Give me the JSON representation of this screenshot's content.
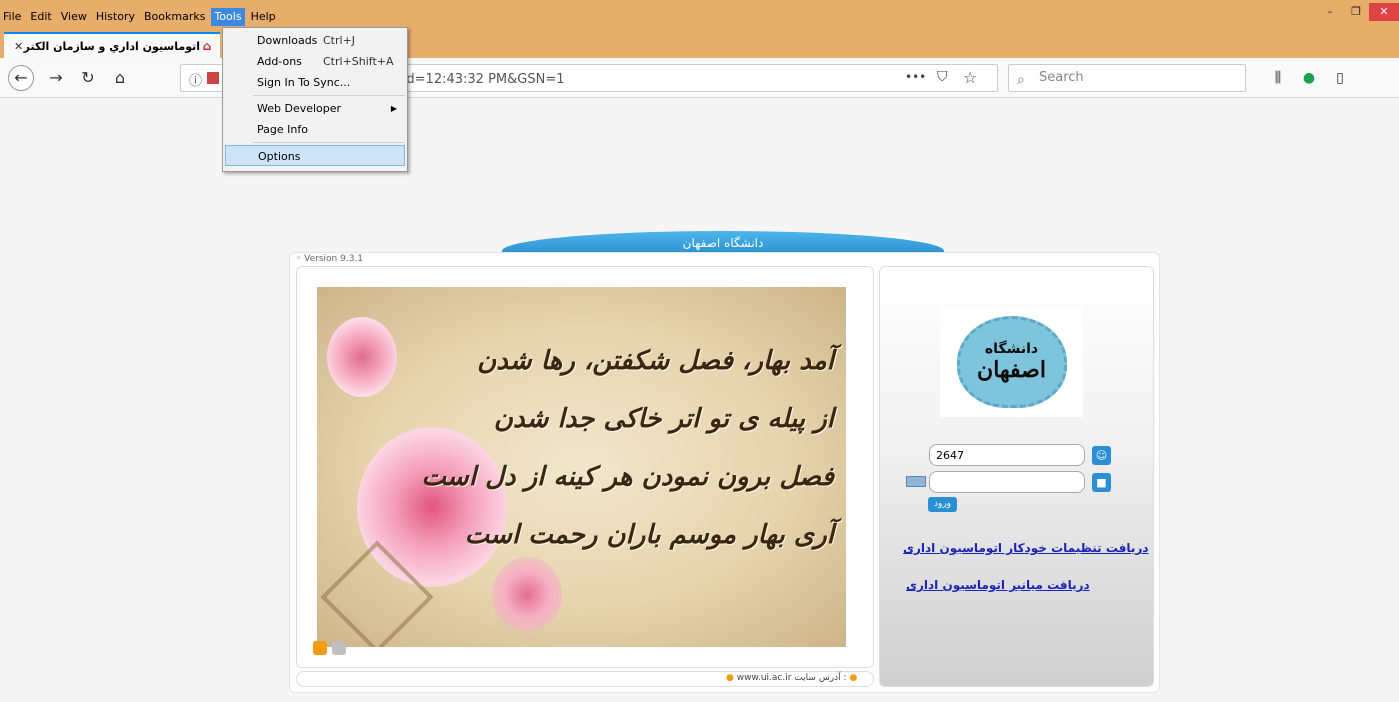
{
  "menubar": {
    "items": [
      {
        "label": "File"
      },
      {
        "label": "Edit"
      },
      {
        "label": "View"
      },
      {
        "label": "History"
      },
      {
        "label": "Bookmarks"
      },
      {
        "label": "Tools"
      },
      {
        "label": "Help"
      }
    ],
    "active": "Tools"
  },
  "window_controls": {
    "minimize": "–",
    "maximize": "❐",
    "close": "✕"
  },
  "tab": {
    "title": "اتوماسیون اداري و سازمان الکترونيک",
    "close": "✕",
    "favicon": "site-logo-icon"
  },
  "navbar": {
    "back": "←",
    "forward": "→",
    "reload": "↻",
    "home": "⌂",
    "url": "an/Login/LoginFrm.aspx?Rnd=12:43:32 PM&GSN=1",
    "info_icon": "ⓘ",
    "more": "•••",
    "pocket": "⛉",
    "bookmark": "☆",
    "search_placeholder": "Search",
    "search_icon": "⌕",
    "library": "⫼",
    "extension": "●",
    "sidebar": "▯"
  },
  "tools_menu": {
    "items": [
      {
        "label": "Downloads",
        "shortcut": "Ctrl+J"
      },
      {
        "label": "Add-ons",
        "shortcut": "Ctrl+Shift+A"
      },
      {
        "label": "Sign In To Sync..."
      },
      {
        "label": "Web Developer",
        "arrow": "▶"
      },
      {
        "label": "Page Info"
      },
      {
        "label": "Options"
      }
    ],
    "selected": "Options"
  },
  "page": {
    "header_title": "دانشگاه اصفهان",
    "version": "◦ Version 9.3.1",
    "poem_lines": [
      "آمد بهار، فصل شکفتن، رها شدن",
      "از پیله ی تو اتر خاکی جدا شدن",
      "فصل برون نمودن هر کینه از دل است",
      "آری بهار موسم باران رحمت است"
    ],
    "footer_label": "آدرس سایت :",
    "footer_url": "www.ui.ac.ir",
    "logo_text_1": "دانشگاه",
    "logo_text_2": "اصفهان",
    "username_value": "2647",
    "password_value": "",
    "login_label": "ورود",
    "link_settings": "دریافت تنظیمات خودکار اتوماسیون اداری",
    "link_helper": "دریافت میانبر اتوماسیون اداری",
    "user_icon": "👤",
    "lock_icon": "🔒"
  },
  "colors": {
    "titlebar": "#e6ad6b",
    "accent_blue": "#2b8fd6",
    "link": "#1a24b8",
    "menu_highlight": "#3d88e0"
  }
}
